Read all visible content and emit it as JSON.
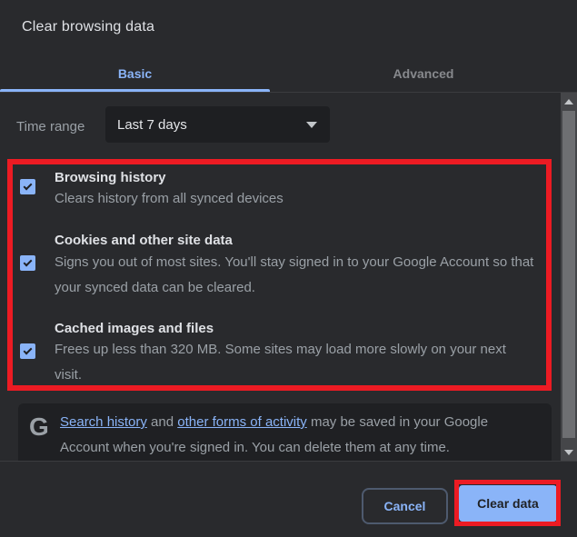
{
  "dialog": {
    "title": "Clear browsing data"
  },
  "tabs": {
    "basic": "Basic",
    "advanced": "Advanced",
    "active": "Basic"
  },
  "time_range": {
    "label": "Time range",
    "value": "Last 7 days"
  },
  "options": [
    {
      "title": "Browsing history",
      "description": "Clears history from all synced devices",
      "checked": true
    },
    {
      "title": "Cookies and other site data",
      "description": "Signs you out of most sites. You'll stay signed in to your Google Account so that your synced data can be cleared.",
      "checked": true
    },
    {
      "title": "Cached images and files",
      "description": "Frees up less than 320 MB. Some sites may load more slowly on your next visit.",
      "checked": true
    }
  ],
  "footer_note": {
    "logo": "G",
    "link1": "Search history",
    "and_text": " and ",
    "link2": "other forms of activity",
    "rest": " may be saved in your Google Account when you're signed in. You can delete them at any time."
  },
  "buttons": {
    "cancel": "Cancel",
    "confirm": "Clear data"
  },
  "colors": {
    "accent_blue": "#8ab4f8",
    "annotation_red": "#ec1b23",
    "background": "#292a2d",
    "panel_dark": "#1f2023",
    "text_primary": "#dfe1e5",
    "text_secondary": "#9aa0a6"
  }
}
